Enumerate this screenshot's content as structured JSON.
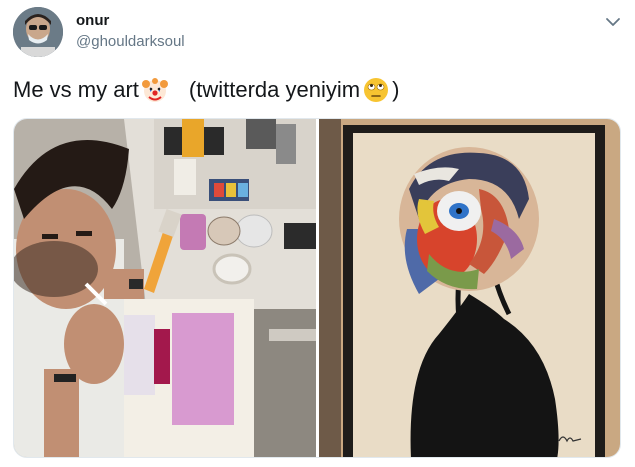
{
  "tweet": {
    "display_name": "onur",
    "handle": "@ghouldarksoul",
    "text_part1": "Me vs my art",
    "text_part2": "(twitterda yeniyim",
    "text_part3": ")",
    "emoji_1": "clown-face",
    "emoji_2": "face-with-rolling-eyes"
  },
  "icons": {
    "menu": "chevron-down-icon"
  },
  "media": {
    "count": 2
  },
  "colors": {
    "handle_gray": "#657786",
    "text_dark": "#14171a",
    "chevron": "#657786"
  }
}
